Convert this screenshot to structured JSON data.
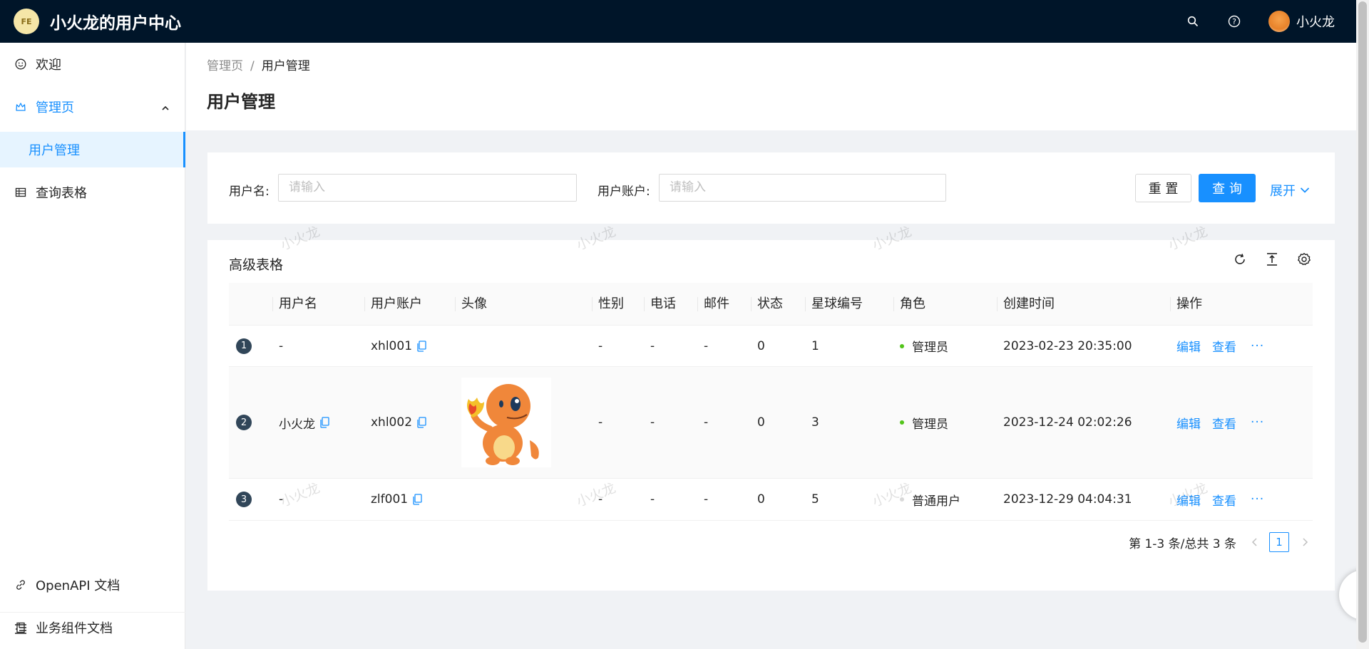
{
  "header": {
    "logo_text": "FE",
    "app_title": "小火龙的用户中心",
    "username": "小火龙",
    "icons": [
      "search-icon",
      "question-circle-icon"
    ]
  },
  "sidebar": {
    "items": [
      {
        "label": "欢迎",
        "icon": "smile-icon"
      },
      {
        "label": "管理页",
        "icon": "crown-icon"
      },
      {
        "label": "用户管理"
      },
      {
        "label": "查询表格",
        "icon": "table-icon"
      },
      {
        "label": "OpenAPI 文档",
        "icon": "link-icon"
      },
      {
        "label": "业务组件文档",
        "icon": "book-icon"
      }
    ]
  },
  "page": {
    "breadcrumb": [
      "管理页",
      "用户管理"
    ],
    "title": "用户管理"
  },
  "search": {
    "username_label": "用户名:",
    "username_placeholder": "请输入",
    "account_label": "用户账户:",
    "account_placeholder": "请输入",
    "reset_label": "重 置",
    "query_label": "查 询",
    "expand_label": "展开"
  },
  "table": {
    "title": "高级表格",
    "columns": [
      "用户名",
      "用户账户",
      "头像",
      "性别",
      "电话",
      "邮件",
      "状态",
      "星球编号",
      "角色",
      "创建时间",
      "操作"
    ],
    "rows": [
      {
        "index": "1",
        "username": "-",
        "account": "xhl001",
        "gender": "-",
        "phone": "-",
        "email": "-",
        "status": "0",
        "planet": "1",
        "role": "管理员",
        "created": "2023-02-23 20:35:00",
        "edit": "编辑",
        "view": "查看",
        "more": "···"
      },
      {
        "index": "2",
        "username": "小火龙",
        "account": "xhl002",
        "gender": "-",
        "phone": "-",
        "email": "-",
        "status": "0",
        "planet": "3",
        "role": "管理员",
        "created": "2023-12-24 02:02:26",
        "edit": "编辑",
        "view": "查看",
        "more": "···"
      },
      {
        "index": "3",
        "username": "-",
        "account": "zlf001",
        "gender": "-",
        "phone": "-",
        "email": "-",
        "status": "0",
        "planet": "5",
        "role": "普通用户",
        "created": "2023-12-29 04:04:31",
        "edit": "编辑",
        "view": "查看",
        "more": "···"
      }
    ],
    "role_colors": {
      "admin": "#52c41a",
      "normal": "#d9d9d9"
    }
  },
  "pagination": {
    "summary": "第 1-3 条/总共 3 条",
    "current_page": "1"
  },
  "watermark_text": "小火龙",
  "colors": {
    "primary": "#1890ff",
    "header_bg": "#001529"
  }
}
